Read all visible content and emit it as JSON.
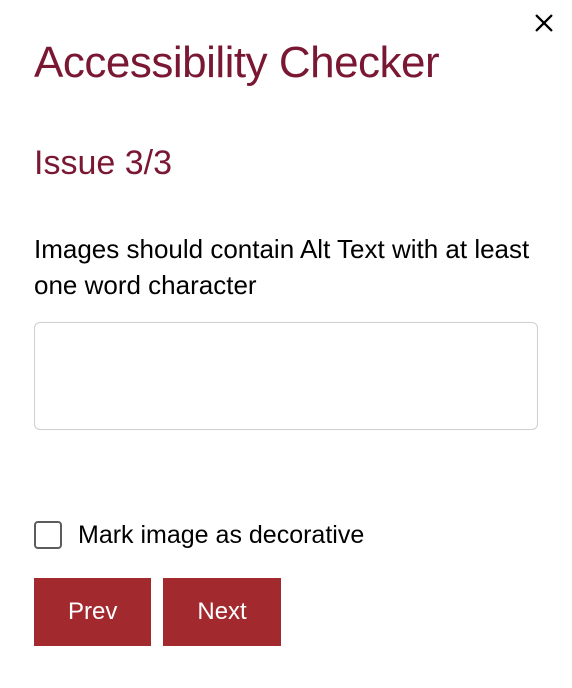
{
  "header": {
    "title": "Accessibility Checker"
  },
  "issue": {
    "heading": "Issue 3/3",
    "description": "Images should contain Alt Text with at least one word character",
    "alt_text_value": ""
  },
  "decorative": {
    "label": "Mark image as decorative",
    "checked": false
  },
  "buttons": {
    "prev": "Prev",
    "next": "Next"
  },
  "icons": {
    "close": "close"
  },
  "colors": {
    "accent": "#7a1733",
    "button": "#a22a2f"
  }
}
